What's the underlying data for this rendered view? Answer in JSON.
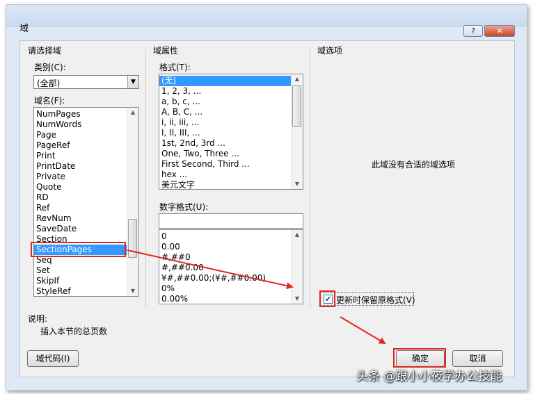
{
  "dialog": {
    "title": "域",
    "help_label": "?",
    "close_label": "✕"
  },
  "left_panel": {
    "group_label": "请选择域",
    "category_label": "类别(C):",
    "category_value": "(全部)",
    "field_names_label": "域名(F):",
    "field_names": [
      "NumPages",
      "NumWords",
      "Page",
      "PageRef",
      "Print",
      "PrintDate",
      "Private",
      "Quote",
      "RD",
      "Ref",
      "RevNum",
      "SaveDate",
      "Section",
      "SectionPages",
      "Seq",
      "Set",
      "SkipIf",
      "StyleRef"
    ],
    "selected_field": "SectionPages"
  },
  "middle_panel": {
    "group_label": "域属性",
    "format_label": "格式(T):",
    "formats": [
      "(无)",
      "1, 2, 3, ...",
      "a, b, c, ...",
      "A, B, C, ...",
      "i, ii, iii, ...",
      "I, II, III, ...",
      "1st, 2nd, 3rd ...",
      "One, Two, Three ...",
      "First Second, Third ...",
      "hex ...",
      "美元文字"
    ],
    "selected_format": "(无)",
    "number_format_label": "数字格式(U):",
    "number_format_value": "",
    "number_formats": [
      "0",
      "0.00",
      "#,##0",
      "#,##0.00",
      "¥#,##0.00;(¥#,##0.00)",
      "0%",
      "0.00%"
    ]
  },
  "right_panel": {
    "group_label": "域选项",
    "no_options_text": "此域没有合适的域选项",
    "preserve_format_label": "更新时保留原格式(V)",
    "preserve_format_checked": true
  },
  "description": {
    "label": "说明:",
    "text": "插入本节的总页数"
  },
  "buttons": {
    "field_codes": "域代码(I)",
    "ok": "确定",
    "cancel": "取消"
  },
  "watermark": "头条 @跟小小筱学办公技能",
  "colors": {
    "selection": "#3399ff",
    "highlight_box": "#e0271c",
    "arrow": "#e0271c"
  }
}
